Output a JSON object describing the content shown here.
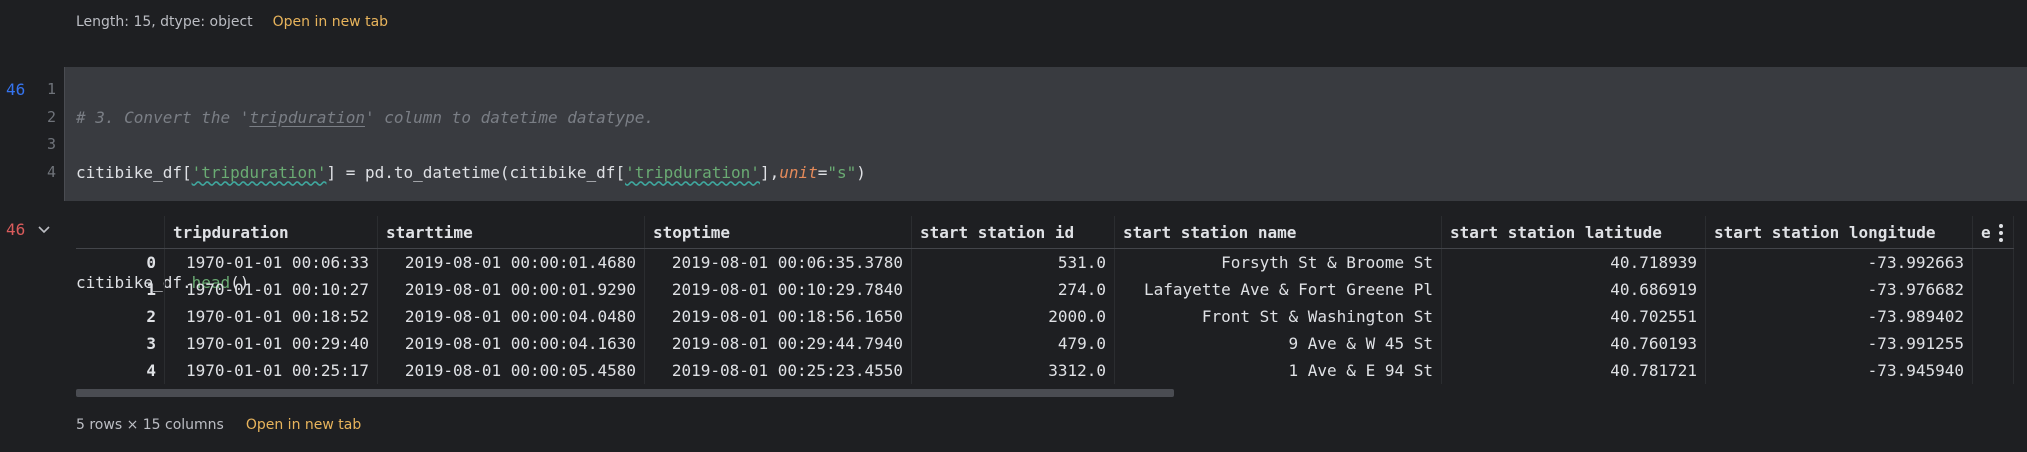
{
  "prev_output": {
    "info": "Length: 15, dtype: object",
    "open_link": "Open in new tab"
  },
  "cell": {
    "exec_count": "46",
    "line_numbers": [
      "1",
      "2",
      "3",
      "4"
    ],
    "code": {
      "line1_comment_pre": "# 3. Convert the '",
      "line1_comment_word": "tripduration",
      "line1_comment_post": "' column to datetime datatype.",
      "line2_var": "citibike_df[",
      "line2_key": "'tripduration'",
      "line2_mid": "] = pd.to_datetime(citibike_df[",
      "line2_key2": "'tripduration'",
      "line2_kw_pre": "],",
      "line2_kw": "unit",
      "line2_eq": "=",
      "line2_val": "\"s\"",
      "line2_end": ")",
      "line4_var": "citibike_df.",
      "line4_call": "head",
      "line4_end": "()"
    }
  },
  "output": {
    "exec_count": "46",
    "columns": [
      "",
      "tripduration",
      "starttime",
      "stoptime",
      "start station id",
      "start station name",
      "start station latitude",
      "start station longitude",
      "e"
    ],
    "rows": [
      [
        "0",
        "1970-01-01 00:06:33",
        "2019-08-01 00:00:01.4680",
        "2019-08-01 00:06:35.3780",
        "531.0",
        "Forsyth St & Broome St",
        "40.718939",
        "-73.992663",
        ""
      ],
      [
        "1",
        "1970-01-01 00:10:27",
        "2019-08-01 00:00:01.9290",
        "2019-08-01 00:10:29.7840",
        "274.0",
        "Lafayette Ave & Fort Greene Pl",
        "40.686919",
        "-73.976682",
        ""
      ],
      [
        "2",
        "1970-01-01 00:18:52",
        "2019-08-01 00:00:04.0480",
        "2019-08-01 00:18:56.1650",
        "2000.0",
        "Front St & Washington St",
        "40.702551",
        "-73.989402",
        ""
      ],
      [
        "3",
        "1970-01-01 00:29:40",
        "2019-08-01 00:00:04.1630",
        "2019-08-01 00:29:44.7940",
        "479.0",
        "9 Ave & W 45 St",
        "40.760193",
        "-73.991255",
        ""
      ],
      [
        "4",
        "1970-01-01 00:25:17",
        "2019-08-01 00:00:05.4580",
        "2019-08-01 00:25:23.4550",
        "3312.0",
        "1 Ave & E 94 St",
        "40.781721",
        "-73.945940",
        ""
      ]
    ],
    "footer_info": "5 rows × 15 columns",
    "footer_link": "Open in new tab"
  },
  "colors": {
    "exec_count_input": "#3574f0",
    "exec_count_output": "#db5c5c",
    "link": "#e8b45c"
  }
}
